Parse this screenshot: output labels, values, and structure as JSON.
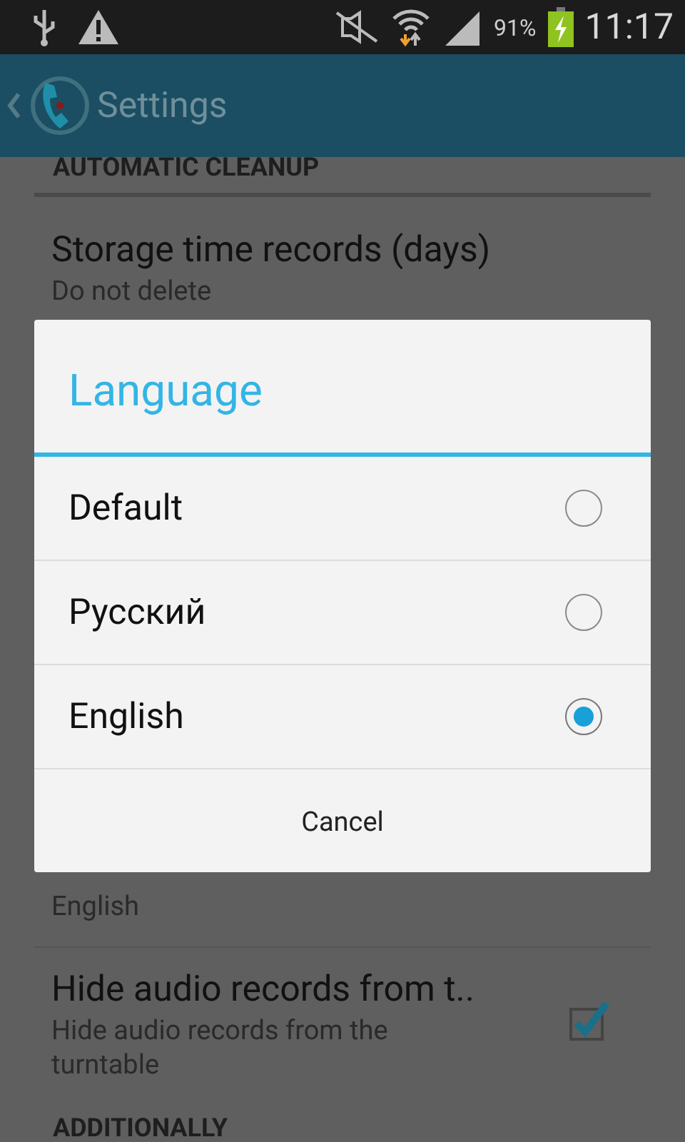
{
  "status_bar": {
    "battery_text": "91%",
    "time": "11:17"
  },
  "action_bar": {
    "title": "Settings"
  },
  "settings": [
    {
      "kind": "header",
      "title": "AUTOMATIC CLEANUP"
    },
    {
      "kind": "item",
      "title": "Storage time records (days)",
      "summary": "Do not delete"
    },
    {
      "kind": "item",
      "summary": "English"
    },
    {
      "kind": "checkbox",
      "title": "Hide audio records from t..",
      "summary": "Hide audio records from the turntable",
      "checked": true
    },
    {
      "kind": "header",
      "title": "ADDITIONALLY"
    }
  ],
  "dialog": {
    "title": "Language",
    "options": [
      {
        "label": "Default",
        "selected": false
      },
      {
        "label": "Русский",
        "selected": false
      },
      {
        "label": "English",
        "selected": true
      }
    ],
    "button": "Cancel"
  }
}
